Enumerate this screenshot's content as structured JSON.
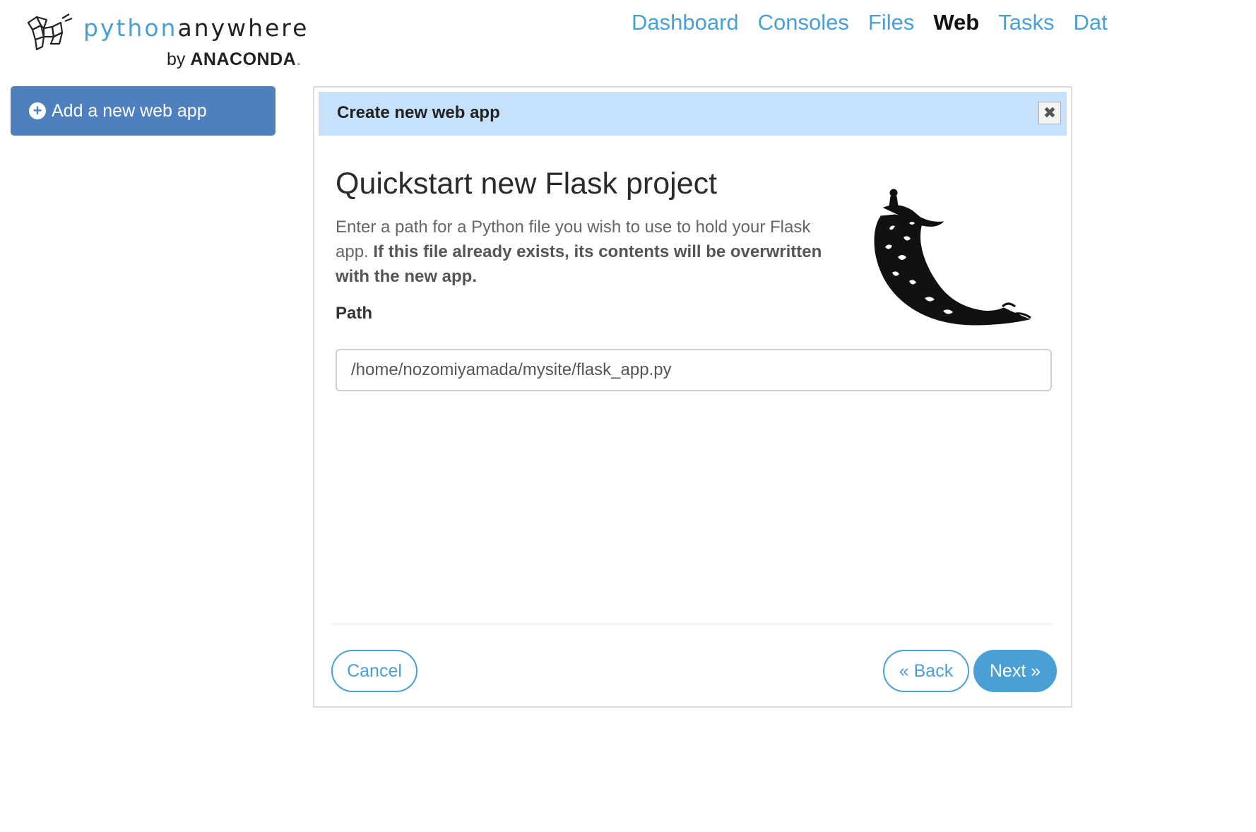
{
  "brand": {
    "word_python": "python",
    "word_anywhere": "anywhere",
    "by_text": "by",
    "company": "ANACONDA",
    "company_dot": "."
  },
  "nav": {
    "items": [
      {
        "label": "Dashboard",
        "active": false
      },
      {
        "label": "Consoles",
        "active": false
      },
      {
        "label": "Files",
        "active": false
      },
      {
        "label": "Web",
        "active": true
      },
      {
        "label": "Tasks",
        "active": false
      },
      {
        "label": "Dat",
        "active": false
      }
    ]
  },
  "sidebar": {
    "add_button_label": "Add a new web app"
  },
  "dialog": {
    "title": "Create new web app",
    "heading": "Quickstart new Flask project",
    "description": "Enter a path for a Python file you wish to use to hold your Flask app.",
    "warning": "If this file already exists, its contents will be overwritten with the new app.",
    "path_label": "Path",
    "path_value": "/home/nozomiyamada/mysite/flask_app.py",
    "cancel_label": "Cancel",
    "back_label": "« Back",
    "next_label": "Next »"
  },
  "colors": {
    "accent": "#4a9fd5",
    "add_button": "#4e7fbf",
    "dialog_header": "#c5e1fb"
  }
}
